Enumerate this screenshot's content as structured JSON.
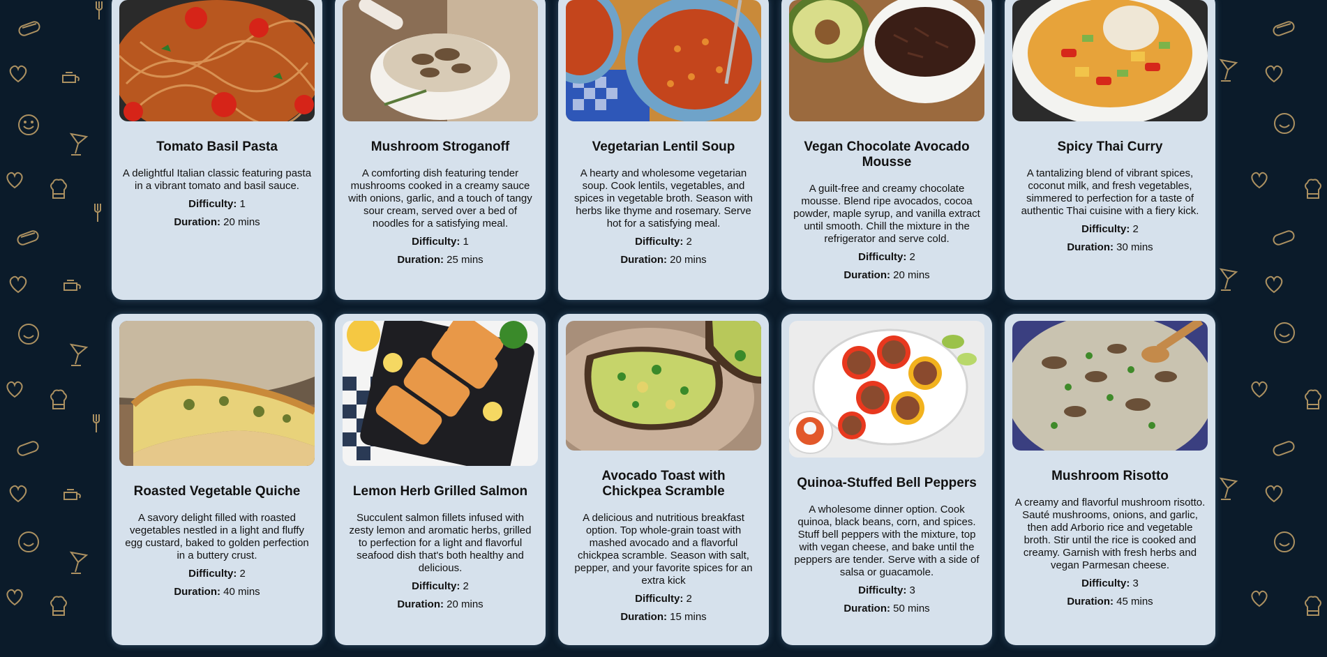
{
  "colors": {
    "background": "#0b1b2a",
    "card": "#d6e1ec",
    "pattern": "#c9a66b"
  },
  "labels": {
    "difficulty": "Difficulty:",
    "duration": "Duration:"
  },
  "recipes": [
    {
      "title": "Tomato Basil Pasta",
      "description": "A delightful Italian classic featuring pasta in a vibrant tomato and basil sauce.",
      "difficulty": "1",
      "duration": "20 mins",
      "image": "pasta-image"
    },
    {
      "title": "Mushroom Stroganoff",
      "description": "A comforting dish featuring tender mushrooms cooked in a creamy sauce with onions, garlic, and a touch of tangy sour cream, served over a bed of noodles for a satisfying meal.",
      "difficulty": "1",
      "duration": "25 mins",
      "image": "stroganoff-image"
    },
    {
      "title": "Vegetarian Lentil Soup",
      "description": "A hearty and wholesome vegetarian soup. Cook lentils, vegetables, and spices in vegetable broth. Season with herbs like thyme and rosemary. Serve hot for a satisfying meal.",
      "difficulty": "2",
      "duration": "20 mins",
      "image": "lentil-soup-image"
    },
    {
      "title": "Vegan Chocolate Avocado Mousse",
      "description": "A guilt-free and creamy chocolate mousse. Blend ripe avocados, cocoa powder, maple syrup, and vanilla extract until smooth. Chill the mixture in the refrigerator and serve cold.",
      "difficulty": "2",
      "duration": "20 mins",
      "image": "mousse-image"
    },
    {
      "title": "Spicy Thai Curry",
      "description": "A tantalizing blend of vibrant spices, coconut milk, and fresh vegetables, simmered to perfection for a taste of authentic Thai cuisine with a fiery kick.",
      "difficulty": "2",
      "duration": "30 mins",
      "image": "curry-image"
    },
    {
      "title": "Roasted Vegetable Quiche",
      "description": "A savory delight filled with roasted vegetables nestled in a light and fluffy egg custard, baked to golden perfection in a buttery crust.",
      "difficulty": "2",
      "duration": "40 mins",
      "image": "quiche-image"
    },
    {
      "title": "Lemon Herb Grilled Salmon",
      "description": "Succulent salmon fillets infused with zesty lemon and aromatic herbs, grilled to perfection for a light and flavorful seafood dish that's both healthy and delicious.",
      "difficulty": "2",
      "duration": "20 mins",
      "image": "salmon-image"
    },
    {
      "title": "Avocado Toast with Chickpea Scramble",
      "description": "A delicious and nutritious breakfast option. Top whole-grain toast with mashed avocado and a flavorful chickpea scramble. Season with salt, pepper, and your favorite spices for an extra kick",
      "difficulty": "2",
      "duration": "15 mins",
      "image": "avocado-toast-image"
    },
    {
      "title": "Quinoa-Stuffed Bell Peppers",
      "description": "A wholesome dinner option. Cook quinoa, black beans, corn, and spices. Stuff bell peppers with the mixture, top with vegan cheese, and bake until the peppers are tender. Serve with a side of salsa or guacamole.",
      "difficulty": "3",
      "duration": "50 mins",
      "image": "stuffed-peppers-image"
    },
    {
      "title": "Mushroom Risotto",
      "description": "A creamy and flavorful mushroom risotto. Sauté mushrooms, onions, and garlic, then add Arborio rice and vegetable broth. Stir until the rice is cooked and creamy. Garnish with fresh herbs and vegan Parmesan cheese.",
      "difficulty": "3",
      "duration": "45 mins",
      "image": "risotto-image"
    }
  ]
}
